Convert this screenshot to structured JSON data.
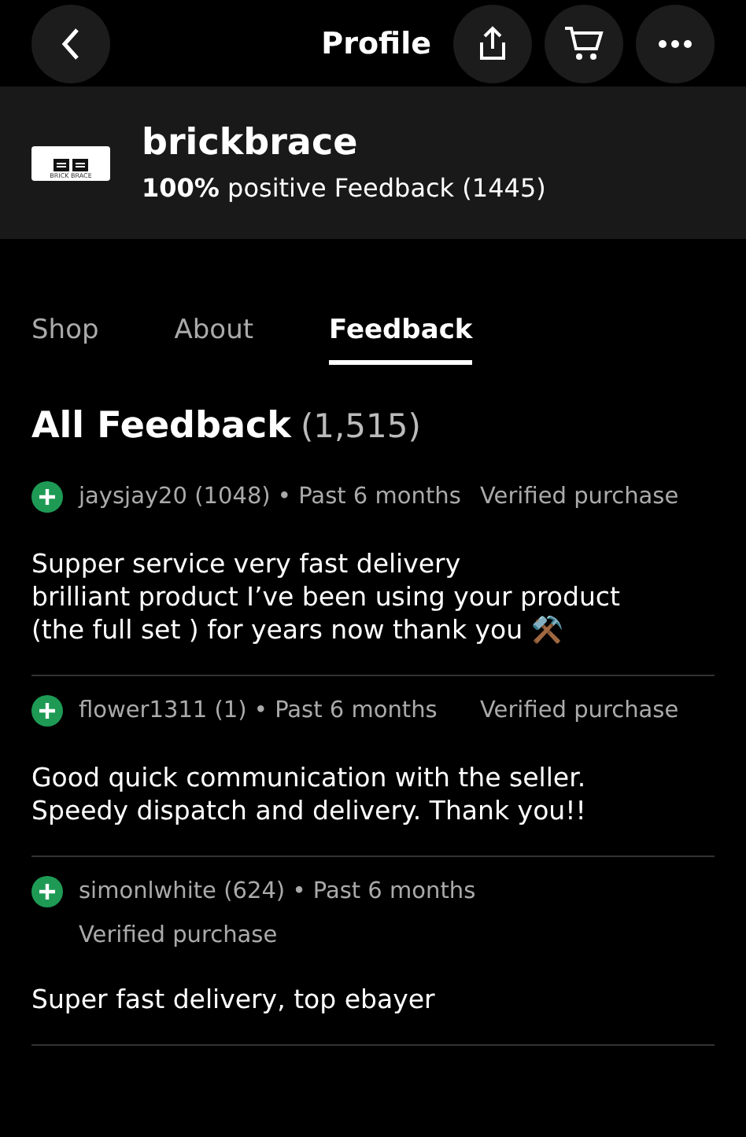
{
  "header": {
    "title": "Profile"
  },
  "seller": {
    "logo_text": "BRICK BRACE",
    "name": "brickbrace",
    "rating": "100%",
    "rating_text": "positive Feedback (1445)"
  },
  "tabs": [
    {
      "label": "Shop",
      "selected": false
    },
    {
      "label": "About",
      "selected": false
    },
    {
      "label": "Feedback",
      "selected": true
    }
  ],
  "feedback": {
    "title": "All Feedback",
    "count": "(1,515)",
    "entries": [
      {
        "kind": "positive",
        "user": "jaysjay20 (1048) • Past 6 months",
        "verified": "Verified purchase",
        "comment": "Supper service very fast delivery\nbrilliant product I’ve been using your product\n(the full set ) for years now thank you ⚒️"
      },
      {
        "kind": "positive",
        "user": "flower1311 (1) • Past 6 months",
        "verified": "Verified purchase",
        "comment": "Good quick communication with the seller.\nSpeedy dispatch and delivery. Thank you!!"
      },
      {
        "kind": "positive",
        "user": "simonlwhite (624) • Past 6 months",
        "verified": "Verified purchase",
        "comment": "Super fast delivery, top ebayer"
      }
    ]
  }
}
